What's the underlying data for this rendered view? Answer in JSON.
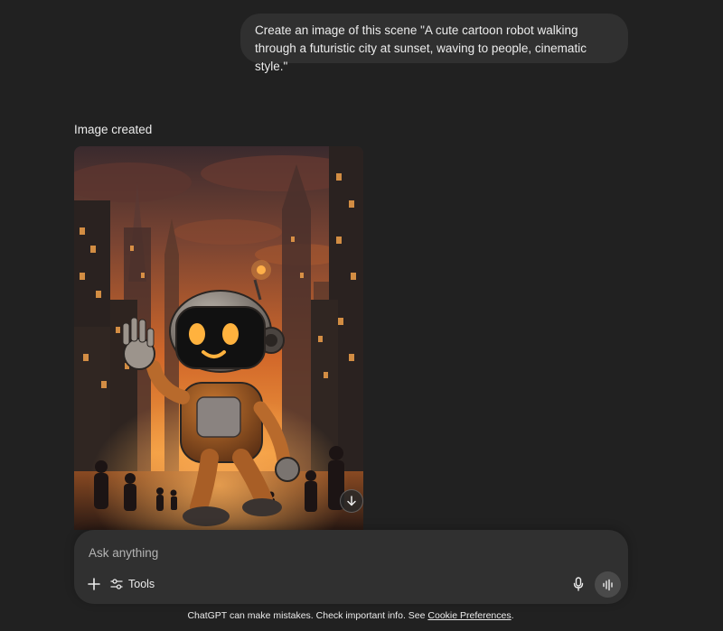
{
  "conversation": {
    "user_message": "Create an image of this scene \"A cute cartoon robot walking through a futuristic city at sunset, waving to people, cinematic style.\"",
    "image_status": "Image created"
  },
  "composer": {
    "placeholder": "Ask anything",
    "tools_label": "Tools"
  },
  "footer": {
    "disclaimer": "ChatGPT can make mistakes. Check important info. See",
    "link_label": "Cookie Preferences",
    "end": "."
  },
  "icons": {
    "download": "download-arrow-icon",
    "plus": "plus-icon",
    "tools": "sliders-icon",
    "mic": "microphone-icon",
    "voice": "voice-waveform-icon"
  },
  "colors": {
    "background": "#212121",
    "surface": "#303030",
    "text": "#ececec",
    "sunset_orange": "#e07a2a"
  }
}
